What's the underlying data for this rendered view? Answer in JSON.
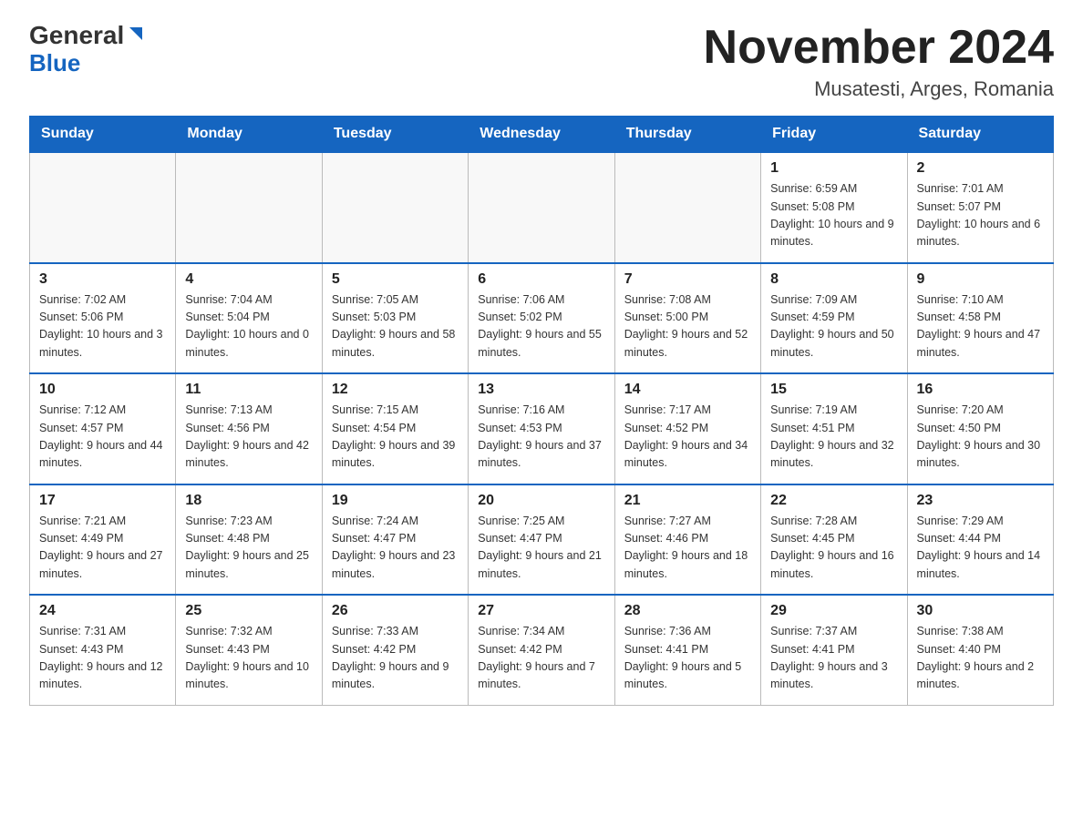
{
  "header": {
    "logo_general": "General",
    "logo_blue": "Blue",
    "month_title": "November 2024",
    "location": "Musatesti, Arges, Romania"
  },
  "weekdays": [
    "Sunday",
    "Monday",
    "Tuesday",
    "Wednesday",
    "Thursday",
    "Friday",
    "Saturday"
  ],
  "weeks": [
    [
      {
        "day": "",
        "info": ""
      },
      {
        "day": "",
        "info": ""
      },
      {
        "day": "",
        "info": ""
      },
      {
        "day": "",
        "info": ""
      },
      {
        "day": "",
        "info": ""
      },
      {
        "day": "1",
        "info": "Sunrise: 6:59 AM\nSunset: 5:08 PM\nDaylight: 10 hours and 9 minutes."
      },
      {
        "day": "2",
        "info": "Sunrise: 7:01 AM\nSunset: 5:07 PM\nDaylight: 10 hours and 6 minutes."
      }
    ],
    [
      {
        "day": "3",
        "info": "Sunrise: 7:02 AM\nSunset: 5:06 PM\nDaylight: 10 hours and 3 minutes."
      },
      {
        "day": "4",
        "info": "Sunrise: 7:04 AM\nSunset: 5:04 PM\nDaylight: 10 hours and 0 minutes."
      },
      {
        "day": "5",
        "info": "Sunrise: 7:05 AM\nSunset: 5:03 PM\nDaylight: 9 hours and 58 minutes."
      },
      {
        "day": "6",
        "info": "Sunrise: 7:06 AM\nSunset: 5:02 PM\nDaylight: 9 hours and 55 minutes."
      },
      {
        "day": "7",
        "info": "Sunrise: 7:08 AM\nSunset: 5:00 PM\nDaylight: 9 hours and 52 minutes."
      },
      {
        "day": "8",
        "info": "Sunrise: 7:09 AM\nSunset: 4:59 PM\nDaylight: 9 hours and 50 minutes."
      },
      {
        "day": "9",
        "info": "Sunrise: 7:10 AM\nSunset: 4:58 PM\nDaylight: 9 hours and 47 minutes."
      }
    ],
    [
      {
        "day": "10",
        "info": "Sunrise: 7:12 AM\nSunset: 4:57 PM\nDaylight: 9 hours and 44 minutes."
      },
      {
        "day": "11",
        "info": "Sunrise: 7:13 AM\nSunset: 4:56 PM\nDaylight: 9 hours and 42 minutes."
      },
      {
        "day": "12",
        "info": "Sunrise: 7:15 AM\nSunset: 4:54 PM\nDaylight: 9 hours and 39 minutes."
      },
      {
        "day": "13",
        "info": "Sunrise: 7:16 AM\nSunset: 4:53 PM\nDaylight: 9 hours and 37 minutes."
      },
      {
        "day": "14",
        "info": "Sunrise: 7:17 AM\nSunset: 4:52 PM\nDaylight: 9 hours and 34 minutes."
      },
      {
        "day": "15",
        "info": "Sunrise: 7:19 AM\nSunset: 4:51 PM\nDaylight: 9 hours and 32 minutes."
      },
      {
        "day": "16",
        "info": "Sunrise: 7:20 AM\nSunset: 4:50 PM\nDaylight: 9 hours and 30 minutes."
      }
    ],
    [
      {
        "day": "17",
        "info": "Sunrise: 7:21 AM\nSunset: 4:49 PM\nDaylight: 9 hours and 27 minutes."
      },
      {
        "day": "18",
        "info": "Sunrise: 7:23 AM\nSunset: 4:48 PM\nDaylight: 9 hours and 25 minutes."
      },
      {
        "day": "19",
        "info": "Sunrise: 7:24 AM\nSunset: 4:47 PM\nDaylight: 9 hours and 23 minutes."
      },
      {
        "day": "20",
        "info": "Sunrise: 7:25 AM\nSunset: 4:47 PM\nDaylight: 9 hours and 21 minutes."
      },
      {
        "day": "21",
        "info": "Sunrise: 7:27 AM\nSunset: 4:46 PM\nDaylight: 9 hours and 18 minutes."
      },
      {
        "day": "22",
        "info": "Sunrise: 7:28 AM\nSunset: 4:45 PM\nDaylight: 9 hours and 16 minutes."
      },
      {
        "day": "23",
        "info": "Sunrise: 7:29 AM\nSunset: 4:44 PM\nDaylight: 9 hours and 14 minutes."
      }
    ],
    [
      {
        "day": "24",
        "info": "Sunrise: 7:31 AM\nSunset: 4:43 PM\nDaylight: 9 hours and 12 minutes."
      },
      {
        "day": "25",
        "info": "Sunrise: 7:32 AM\nSunset: 4:43 PM\nDaylight: 9 hours and 10 minutes."
      },
      {
        "day": "26",
        "info": "Sunrise: 7:33 AM\nSunset: 4:42 PM\nDaylight: 9 hours and 9 minutes."
      },
      {
        "day": "27",
        "info": "Sunrise: 7:34 AM\nSunset: 4:42 PM\nDaylight: 9 hours and 7 minutes."
      },
      {
        "day": "28",
        "info": "Sunrise: 7:36 AM\nSunset: 4:41 PM\nDaylight: 9 hours and 5 minutes."
      },
      {
        "day": "29",
        "info": "Sunrise: 7:37 AM\nSunset: 4:41 PM\nDaylight: 9 hours and 3 minutes."
      },
      {
        "day": "30",
        "info": "Sunrise: 7:38 AM\nSunset: 4:40 PM\nDaylight: 9 hours and 2 minutes."
      }
    ]
  ]
}
